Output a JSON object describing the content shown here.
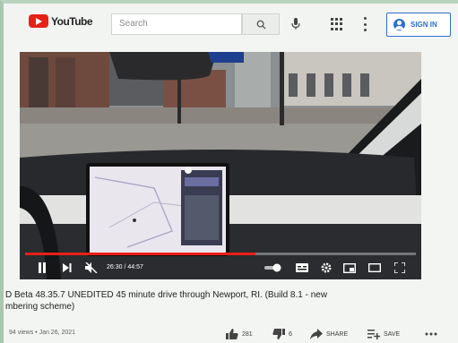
{
  "header": {
    "logo_text": "YouTube",
    "search_placeholder": "Search",
    "signin_label": "SIGN IN"
  },
  "player": {
    "time": "26:30 / 44:57",
    "progress": 0.59
  },
  "video": {
    "title_line1": "D Beta 48.35.7 UNEDITED 45 minute drive through Newport, RI. (Build 8.1 - new",
    "title_line2": "mbering scheme)",
    "meta": "94 views • Jan 26, 2021",
    "likes": "281",
    "dislikes": "6",
    "share_label": "SHARE",
    "save_label": "SAVE"
  },
  "colors": {
    "brand": "#e62117",
    "link": "#2d6fcf"
  }
}
